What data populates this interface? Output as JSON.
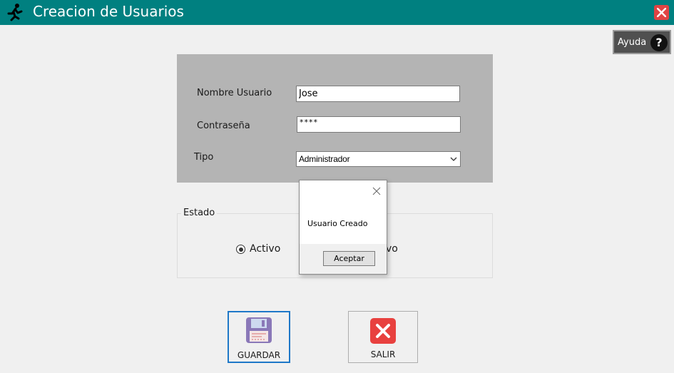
{
  "window": {
    "title": "Creacion de Usuarios"
  },
  "help": {
    "label": "Ayuda",
    "glyph": "?"
  },
  "form": {
    "username_label": "Nombre Usuario",
    "username_value": "Jose",
    "password_label": "Contraseña",
    "password_value": "****",
    "type_label": "Tipo",
    "type_value": "Administrador"
  },
  "estado": {
    "legend": "Estado",
    "active_label": "Activo",
    "inactive_label_visible": "vo",
    "selected": "Activo"
  },
  "dialog": {
    "message": "Usuario Creado",
    "accept_label": "Aceptar"
  },
  "buttons": {
    "save_label": "GUARDAR",
    "exit_label": "SALIR"
  },
  "colors": {
    "titlebar": "#008080",
    "panel": "#b4b4b4",
    "close": "#e04343",
    "save_border": "#1e78c8",
    "exit_icon": "#e8413f"
  },
  "icons": {
    "app": "running-figure-icon",
    "close": "close-icon",
    "help": "question-icon",
    "dropdown": "chevron-down-icon",
    "save": "floppy-disk-icon",
    "exit": "x-box-icon"
  }
}
